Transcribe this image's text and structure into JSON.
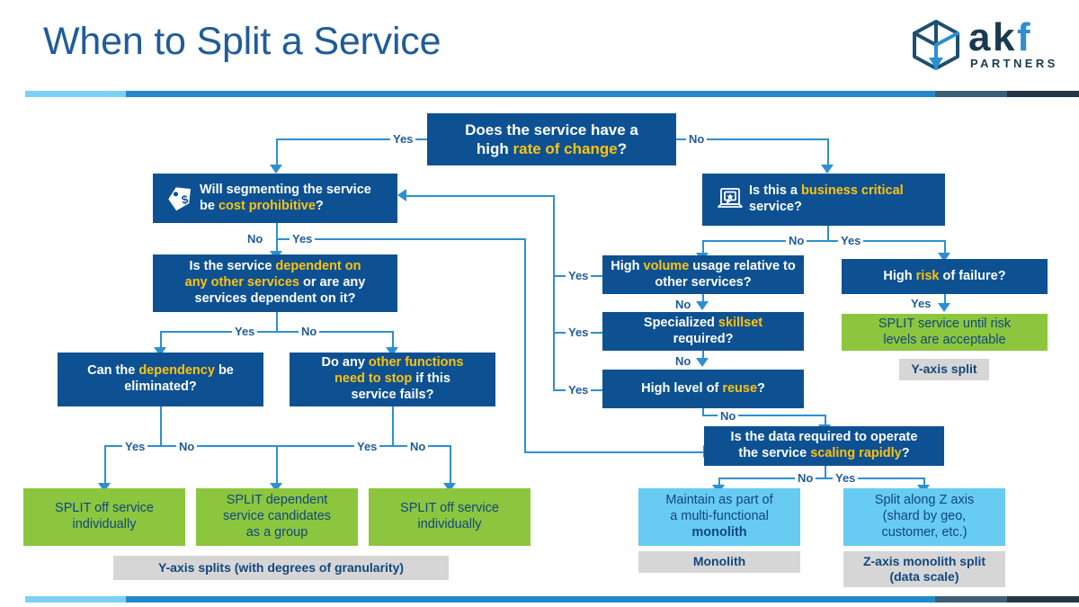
{
  "header": {
    "title": "When to Split a Service",
    "logo": {
      "brand": "akf",
      "tagline": "PARTNERS"
    },
    "rule_colors": {
      "light": "#7DD0F5",
      "mid": "#2389CB",
      "slate": "#3C5E77",
      "navy": "#253746"
    }
  },
  "palette": {
    "decision_blue": "#0D5193",
    "result_green": "#8CC63F",
    "result_cyan": "#67CBF2",
    "caption_grey": "#D6D6D6",
    "connector_blue": "#2E8FD0",
    "highlight_yellow": "#FFC20E",
    "title_blue": "#1F5C99"
  },
  "nodes": {
    "root": {
      "line1_pre": "Does the service have a",
      "line2_pre": "high ",
      "line2_hl": "rate of change",
      "line2_post": "?"
    },
    "cost": {
      "pre": "Will segmenting the service",
      "line2_pre": "be ",
      "line2_hl": "cost prohibitive",
      "line2_post": "?",
      "icon": "price-tag-icon"
    },
    "dependent": {
      "line1_pre": "Is the service ",
      "line1_hl": "dependent on",
      "line2_hl": "any other services",
      "line2_post": " or are any",
      "line3": "services dependent on it?"
    },
    "can_elim": {
      "pre": "Can the ",
      "hl": "dependency",
      "post": " be",
      "line2": "eliminated?"
    },
    "other_funcs": {
      "line1_pre": "Do any ",
      "line1_hl": "other functions",
      "line2_hl": "need to stop",
      "line2_post": " if this",
      "line3": "service fails?"
    },
    "biz_critical": {
      "pre": "Is this a ",
      "hl": "business critical",
      "post": "",
      "line2": "service?",
      "icon": "laptop-review-icon"
    },
    "volume": {
      "pre": "High ",
      "hl": "volume",
      "post": " usage relative to",
      "line2": "other services?"
    },
    "skillset": {
      "pre": "Specialized ",
      "hl": "skillset",
      "post": "",
      "line2": "required?"
    },
    "reuse": {
      "pre": "High level of ",
      "hl": "reuse",
      "post": "?"
    },
    "risk": {
      "pre": "High ",
      "hl": "risk",
      "post": " of failure?"
    },
    "scaling": {
      "line1": "Is the data required to operate",
      "line2_pre": "the service ",
      "line2_hl": "scaling rapidly",
      "line2_post": "?"
    }
  },
  "results": {
    "split_left": {
      "line1": "SPLIT off service",
      "line2": "individually"
    },
    "split_group": {
      "line1": "SPLIT dependent",
      "line2": "service candidates",
      "line3": "as a group"
    },
    "split_right": {
      "line1": "SPLIT off service",
      "line2": "individually"
    },
    "split_risk": {
      "line1": "SPLIT service until risk",
      "line2": "levels are acceptable"
    },
    "monolith": {
      "line1": "Maintain as part of",
      "line2": "a multi-functional",
      "line3_bold": "monolith"
    },
    "zsplit": {
      "line1": "Split along Z axis",
      "line2": "(shard by geo,",
      "line3": "customer, etc.)"
    }
  },
  "captions": {
    "y_axis_splits": "Y-axis splits (with degrees of granularity)",
    "y_axis_split": "Y-axis split",
    "monolith": "Monolith",
    "z_axis_split_l1": "Z-axis monolith split",
    "z_axis_split_l2": "(data scale)"
  },
  "edge_labels": {
    "root_yes": "Yes",
    "root_no": "No",
    "cost_no": "No",
    "cost_yes": "Yes",
    "dep_yes": "Yes",
    "dep_no": "No",
    "elim_yes": "Yes",
    "elim_no": "No",
    "funcs_yes": "Yes",
    "funcs_no": "No",
    "biz_no": "No",
    "biz_yes": "Yes",
    "volume_yes": "Yes",
    "volume_no": "No",
    "skillset_yes": "Yes",
    "skillset_no": "No",
    "reuse_yes": "Yes",
    "reuse_no": "No",
    "risk_yes": "Yes",
    "scaling_no": "No",
    "scaling_yes": "Yes"
  }
}
